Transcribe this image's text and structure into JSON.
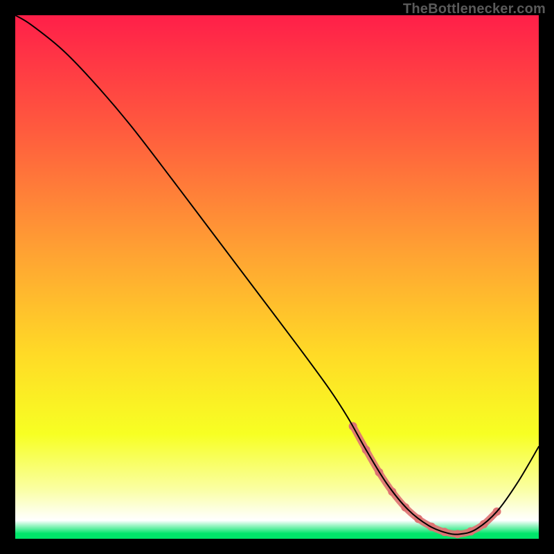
{
  "watermark": "TheBottlenecker.com",
  "chart_data": {
    "type": "line",
    "title": "",
    "xlabel": "",
    "ylabel": "",
    "xlim": [
      0,
      100
    ],
    "ylim": [
      0,
      100
    ],
    "grid": false,
    "legend": false,
    "background": {
      "gradient_stops": [
        {
          "offset": 0.0,
          "color": "#ff1f49"
        },
        {
          "offset": 0.22,
          "color": "#ff5b3e"
        },
        {
          "offset": 0.45,
          "color": "#ffa133"
        },
        {
          "offset": 0.65,
          "color": "#ffdb26"
        },
        {
          "offset": 0.8,
          "color": "#f7ff23"
        },
        {
          "offset": 0.905,
          "color": "#faffa2"
        },
        {
          "offset": 0.945,
          "color": "#fdffe2"
        },
        {
          "offset": 0.965,
          "color": "#ffffff"
        },
        {
          "offset": 0.99,
          "color": "#00e66a"
        }
      ]
    },
    "series": [
      {
        "name": "bottleneck-curve",
        "stroke": "#000000",
        "stroke_width": 2,
        "x": [
          0,
          3,
          9,
          15,
          22,
          30,
          38,
          46,
          54,
          60,
          63.5,
          67,
          71,
          75,
          79,
          82.5,
          85,
          88,
          92,
          96,
          100
        ],
        "y": [
          100,
          98.2,
          93.4,
          87.2,
          79.0,
          68.6,
          58.0,
          47.4,
          36.8,
          28.6,
          23.2,
          17.0,
          10.5,
          5.6,
          2.5,
          1.1,
          0.9,
          1.8,
          5.2,
          10.8,
          17.6
        ]
      }
    ],
    "highlight": {
      "name": "optimal-band",
      "stroke": "#dd7373",
      "stroke_width": 10,
      "dots_radius": 6,
      "x": [
        64.5,
        67,
        69.5,
        72,
        74.5,
        77,
        79.5,
        82,
        84.5,
        87,
        89.5,
        92
      ],
      "y": [
        21.5,
        17.0,
        12.7,
        9.0,
        6.0,
        3.8,
        2.3,
        1.3,
        0.9,
        1.4,
        2.8,
        5.2
      ]
    }
  }
}
